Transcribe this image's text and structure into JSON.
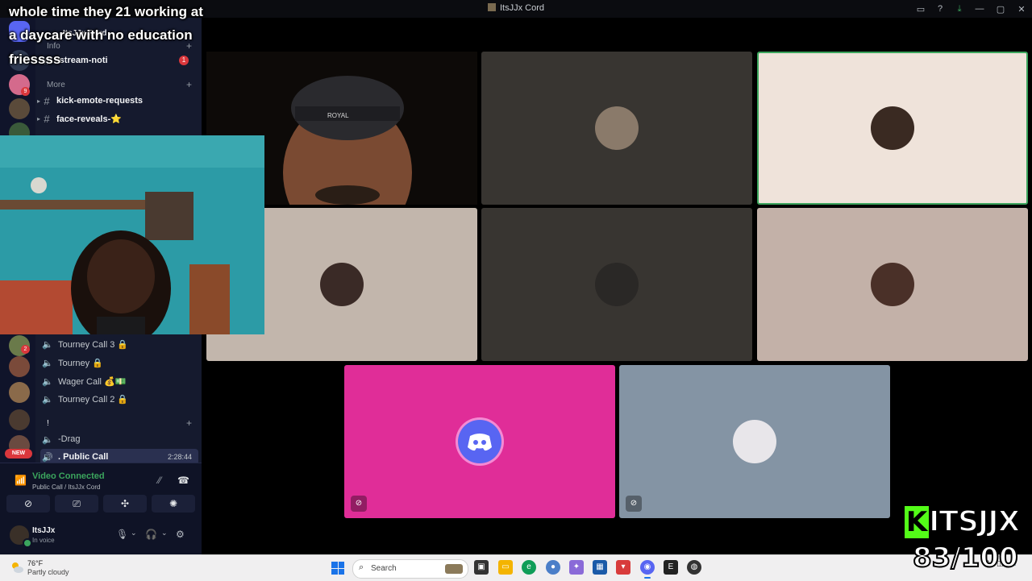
{
  "window": {
    "title": "ItsJJx Cord"
  },
  "overlay": {
    "caption_line1": "whole time they 21 working at",
    "caption_line2": "a daycare with no education",
    "caption_line3": "friessss",
    "brand_name": "ITSJJX",
    "brand_k": "K",
    "progress": "83/100"
  },
  "sidebar": {
    "server_name": "ItsJJx Cord",
    "categories": {
      "info": "Info",
      "more": "More",
      "bang": "!"
    },
    "text_channels": [
      {
        "name": "-stream-noti",
        "badge": "1"
      },
      {
        "name": "kick-emote-requests"
      },
      {
        "name": "face-reveals-⭐"
      }
    ],
    "voice_channels": [
      {
        "name": "Tourney Call 3 🔒"
      },
      {
        "name": "Tourney 🔒"
      },
      {
        "name": "Wager Call 💰💵"
      },
      {
        "name": "Tourney Call 2 🔒"
      },
      {
        "name": "-Drag"
      },
      {
        "name": ". Public Call",
        "time": "2:28:44"
      }
    ],
    "new_badge": "NEW",
    "guild_badges": [
      "9",
      "2"
    ]
  },
  "voice_connection": {
    "status": "Video Connected",
    "location": "Public Call / ItsJJx Cord"
  },
  "user": {
    "name": "ItsJJx",
    "status": "In voice"
  },
  "taskbar": {
    "weather_temp": "76°F",
    "weather_desc": "Partly cloudy",
    "search_label": "Search"
  },
  "colors": {
    "discord_pink": "#e02d98",
    "speaking_green": "#3ba55d",
    "kick_green": "#53fc18"
  },
  "icons": {
    "discord": "discord-logo-icon",
    "muted": "microphone-slash-icon",
    "video_off": "video-slash-icon"
  }
}
